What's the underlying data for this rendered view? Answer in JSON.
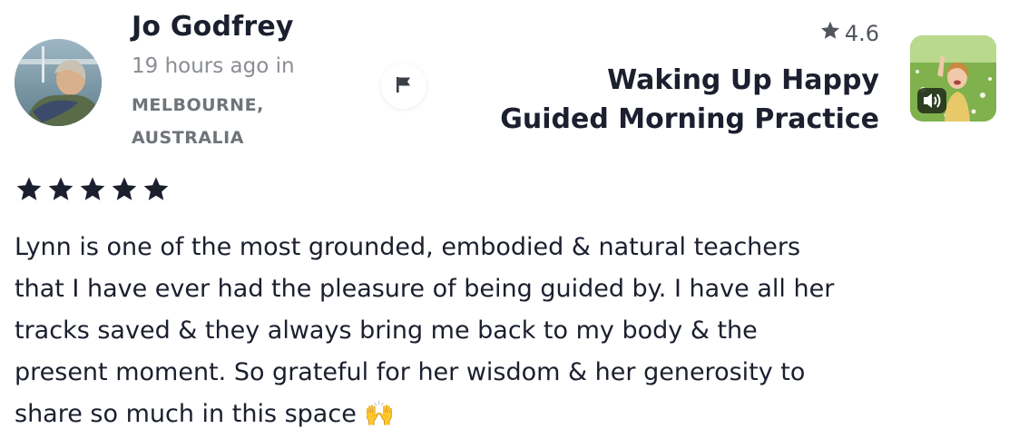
{
  "review": {
    "author_name": "Jo Godfrey",
    "time_ago": "19 hours ago in",
    "location": "MELBOURNE, AUSTRALIA",
    "star_rating": 5,
    "text": "Lynn is one of the most grounded, embodied & natural teachers\nthat I have ever had the pleasure of being guided by. I have all her\ntracks saved & they always bring me back to my body & the\npresent moment. So grateful for her wisdom & her generosity to\nshare so much in this space 🙌"
  },
  "track": {
    "rating": "4.6",
    "title": "Waking Up Happy Guided Morning Practice"
  },
  "icons": {
    "flag": "flag-icon",
    "rating_star": "star-icon",
    "media_badge": "video-speaker-icon"
  },
  "colors": {
    "text_primary": "#1b1f2e",
    "text_muted": "#8a8d93",
    "star": "#1b1f2e"
  }
}
